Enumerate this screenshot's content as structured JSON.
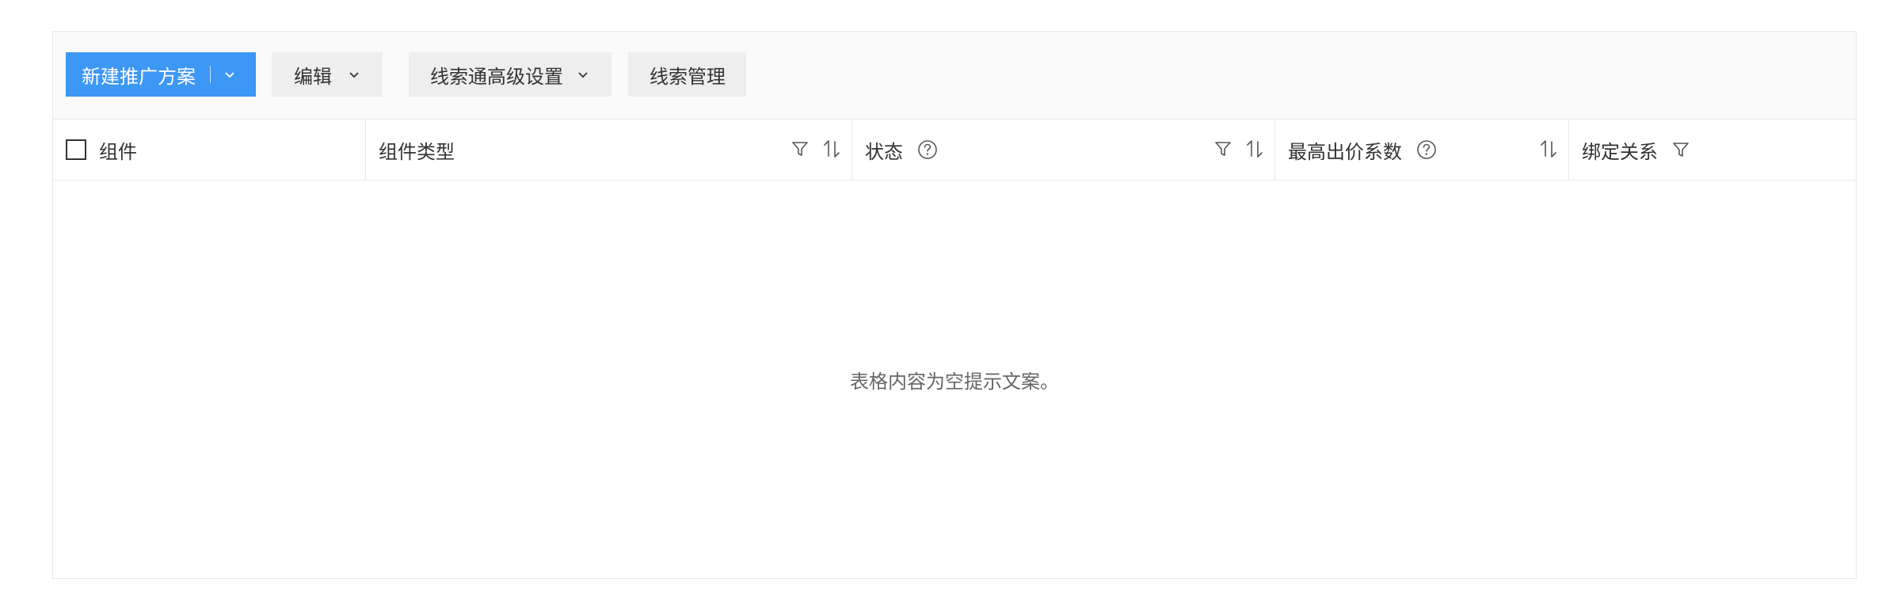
{
  "toolbar": {
    "new_plan_label": "新建推广方案",
    "edit_label": "编辑",
    "clue_settings_label": "线索通高级设置",
    "clue_manage_label": "线索管理"
  },
  "table": {
    "columns": [
      {
        "label": "组件"
      },
      {
        "label": "组件类型"
      },
      {
        "label": "状态"
      },
      {
        "label": "最高出价系数"
      },
      {
        "label": "绑定关系"
      }
    ],
    "empty_text": "表格内容为空提示文案。"
  },
  "colors": {
    "primary": "#3d97f5",
    "border": "#e8e8e8",
    "toolbar_bg": "#fafafa",
    "button_gray": "#eeeeee"
  },
  "icons": {
    "dropdown": "chevron-down-icon",
    "filter": "filter-icon",
    "sort": "sort-icon",
    "help": "help-icon"
  }
}
